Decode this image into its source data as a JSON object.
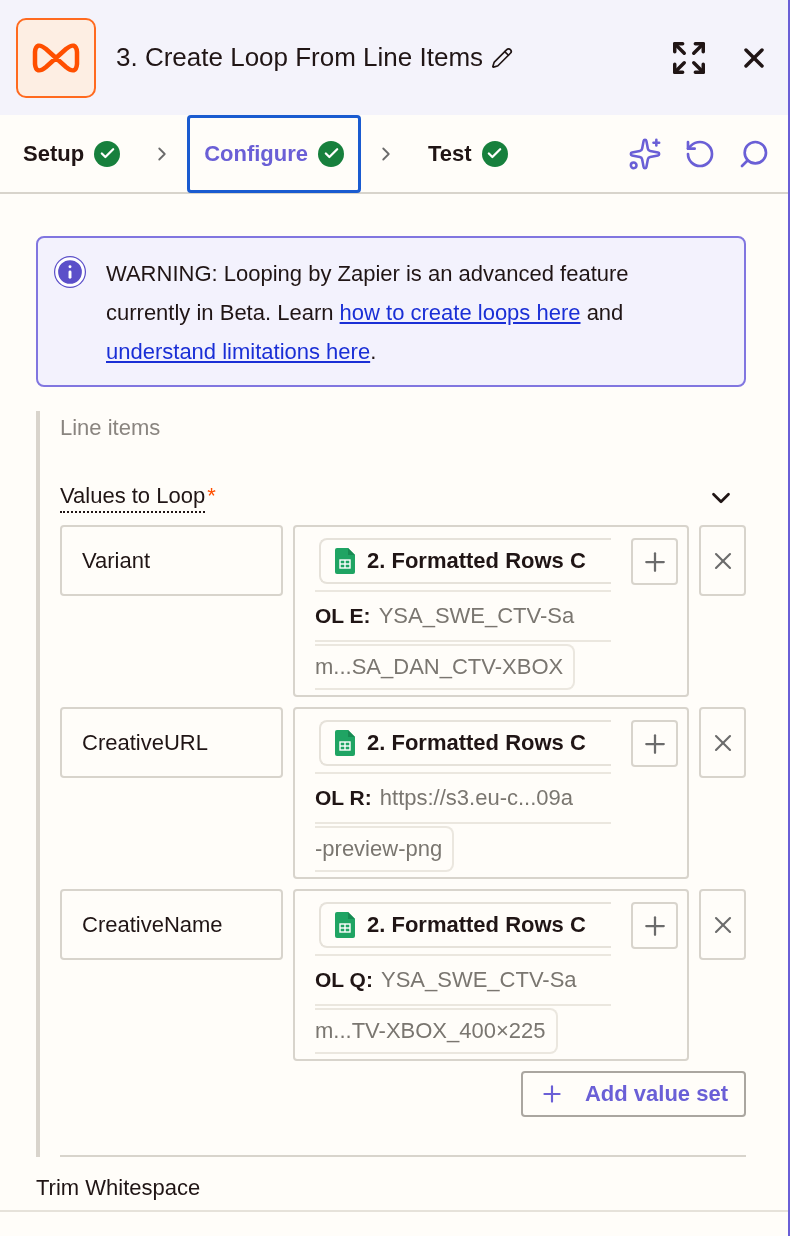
{
  "header": {
    "title": "3. Create Loop From Line Items"
  },
  "steps": [
    {
      "label": "Setup",
      "done": true,
      "selected": false
    },
    {
      "label": "Configure",
      "done": true,
      "selected": true
    },
    {
      "label": "Test",
      "done": true,
      "selected": false
    }
  ],
  "warning": {
    "segments": [
      {
        "kind": "text",
        "text": "WARNING: Looping by Zapier is an advanced feature currently in Beta. Learn "
      },
      {
        "kind": "link",
        "text": "how to create loops here"
      },
      {
        "kind": "text",
        "text": " and "
      },
      {
        "kind": "link",
        "text": "understand limitations here"
      },
      {
        "kind": "text",
        "text": "."
      }
    ]
  },
  "section": {
    "title": "Line items",
    "field_label": "Values to Loop",
    "required": true,
    "required_mark": "*",
    "expanded": true,
    "rows": [
      {
        "key": "Variant",
        "source": "2. Formatted Rows C",
        "column": "OL E:",
        "value": "YSA_SWE_CTV-Sa",
        "continuation": "m...SA_DAN_CTV-XBOX"
      },
      {
        "key": "CreativeURL",
        "source": "2. Formatted Rows C",
        "column": "OL R:",
        "value": "https://s3.eu-c...09a",
        "continuation": "-preview-png"
      },
      {
        "key": "CreativeName",
        "source": "2. Formatted Rows C",
        "column": "OL Q:",
        "value": "YSA_SWE_CTV-Sa",
        "continuation": "m...TV-XBOX_400×225"
      }
    ],
    "add_button": "Add value set"
  },
  "next_field": "Trim Whitespace"
}
